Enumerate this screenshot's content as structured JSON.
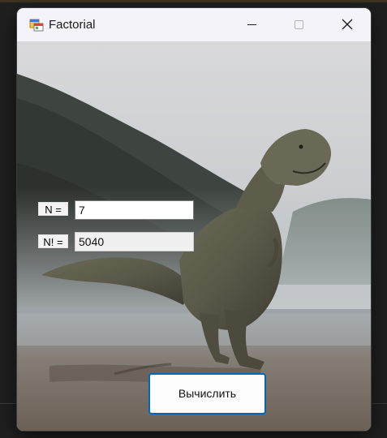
{
  "window": {
    "title": "Factorial",
    "icon": "winforms-app-icon",
    "controls": [
      "minimize-icon",
      "maximize-icon",
      "close-icon"
    ]
  },
  "form": {
    "n_label": "N =",
    "n_value": "7",
    "result_label": "N! =",
    "result_value": "5040",
    "calculate_label": "Вычислить"
  },
  "background": {
    "description_icon": "t-rex-background-image"
  },
  "colors": {
    "titlebar": "#f3f3f9",
    "button_border": "#0067c0"
  }
}
